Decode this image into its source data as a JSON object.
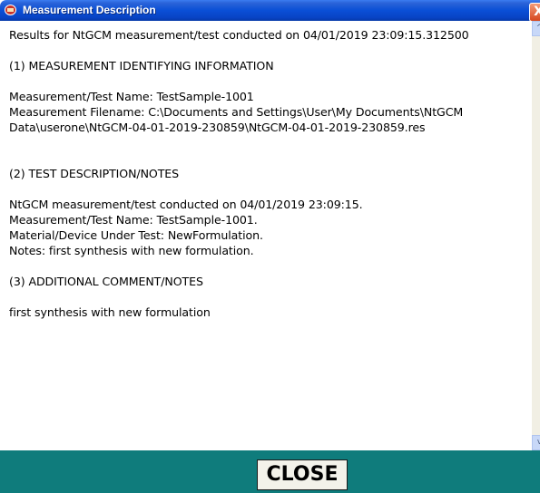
{
  "window": {
    "title": "Measurement Description",
    "close_glyph": "X",
    "icon": "app-logo-icon"
  },
  "content": {
    "text": "Results for NtGCM measurement/test conducted on 04/01/2019 23:09:15.312500\n\n(1) MEASUREMENT IDENTIFYING INFORMATION\n\nMeasurement/Test Name: TestSample-1001\nMeasurement Filename: C:\\Documents and Settings\\User\\My Documents\\NtGCM\nData\\userone\\NtGCM-04-01-2019-230859\\NtGCM-04-01-2019-230859.res\n\n\n(2) TEST DESCRIPTION/NOTES\n\nNtGCM measurement/test conducted on 04/01/2019 23:09:15.\nMeasurement/Test Name: TestSample-1001.\nMaterial/Device Under Test: NewFormulation.\nNotes: first synthesis with new formulation.\n\n(3) ADDITIONAL COMMENT/NOTES\n\nfirst synthesis with new formulation"
  },
  "scrollbar": {
    "up_glyph": "^",
    "down_glyph": "v"
  },
  "footer": {
    "close_label": "CLOSE"
  },
  "colors": {
    "titlebar": "#0a4fd6",
    "footer_bg": "#0f7c7c",
    "button_bg": "#f3f2ea"
  }
}
